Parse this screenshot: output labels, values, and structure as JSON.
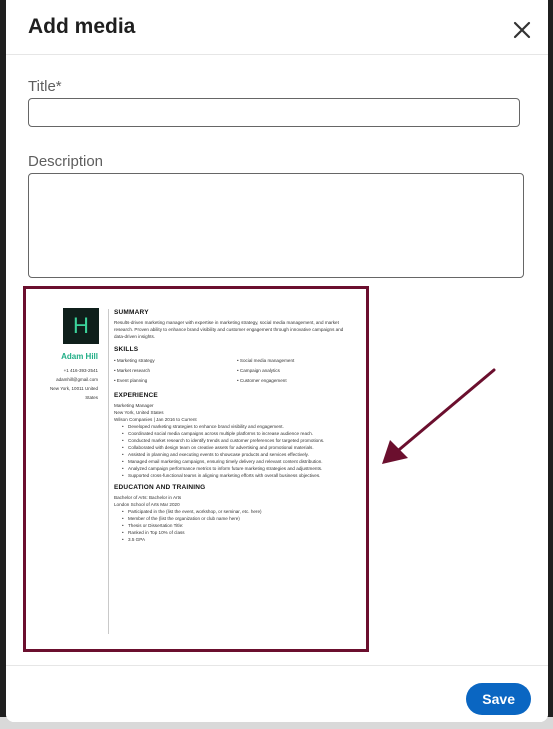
{
  "modal": {
    "title": "Add media",
    "close_icon": "close-icon"
  },
  "form": {
    "title_label": "Title*",
    "title_value": "",
    "description_label": "Description",
    "description_value": ""
  },
  "resume": {
    "initial": "H",
    "name": "Adam Hill",
    "contact": [
      "+1 416-393-2541",
      "adamhill@gmail.com",
      "New York, 10011 United",
      "States"
    ],
    "summary_heading": "SUMMARY",
    "summary_text": "Results-driven marketing manager with expertise in marketing strategy, social media management, and market research. Proven ability to enhance brand visibility and customer engagement through innovative campaigns and data-driven insights.",
    "skills_heading": "SKILLS",
    "skills": [
      "Marketing strategy",
      "Social media management",
      "Market research",
      "Campaign analytics",
      "Event planning",
      "Customer engagement"
    ],
    "experience_heading": "EXPERIENCE",
    "job_title": "Marketing Manager",
    "job_location": "New York, United States",
    "job_company": "Wilson Companies | Jan 2016 to Current",
    "job_bullets": [
      "Developed marketing strategies to enhance brand visibility and engagement.",
      "Coordinated social media campaigns across multiple platforms to increase audience reach.",
      "Conducted market research to identify trends and customer preferences for targeted promotions.",
      "Collaborated with design team on creative assets for advertising and promotional materials.",
      "Assisted in planning and executing events to showcase products and services effectively.",
      "Managed email marketing campaigns, ensuring timely delivery and relevant content distribution.",
      "Analyzed campaign performance metrics to inform future marketing strategies and adjustments.",
      "Supported cross-functional teams in aligning marketing efforts with overall business objectives."
    ],
    "education_heading": "EDUCATION AND TRAINING",
    "degree": "Bachelor of Arts: Bachelor in Arts",
    "school": "London School of Arts Mar 2020",
    "edu_bullets": [
      "Participated in the (list the event, workshop, or seminar, etc. here)",
      "Member of the (list the organization or club name here)",
      "Thesis or Dissertation Title:",
      "Ranked in Top 10% of class",
      "3.5 GPA"
    ]
  },
  "annotation": {
    "arrow_color": "#6b0f2e",
    "frame_color": "#6b0f2e"
  },
  "footer": {
    "save_label": "Save"
  },
  "colors": {
    "primary": "#0a66c2",
    "accent": "#1fae86"
  }
}
